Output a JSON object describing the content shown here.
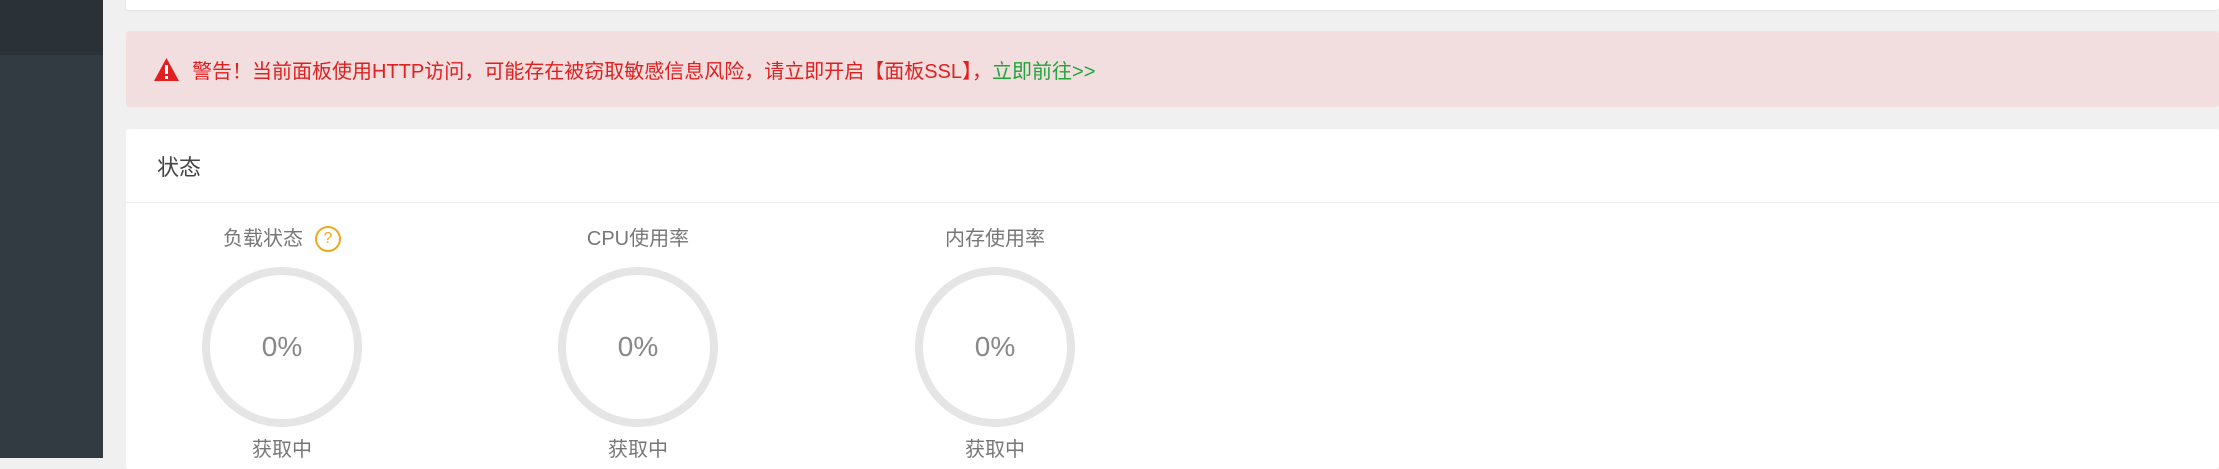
{
  "warning": {
    "text": "警告！当前面板使用HTTP访问，可能存在被窃取敏感信息风险，请立即开启【面板SSL】，",
    "link": "立即前往>>"
  },
  "status": {
    "title": "状态",
    "gauges": [
      {
        "label": "负载状态",
        "value": "0%",
        "status": "获取中",
        "has_help": true
      },
      {
        "label": "CPU使用率",
        "value": "0%",
        "status": "获取中"
      },
      {
        "label": "内存使用率",
        "value": "0%",
        "status": "获取中"
      }
    ]
  },
  "colors": {
    "sidebar": "#333b42",
    "warning_text": "#e02020",
    "warning_bg": "#f2dede",
    "link_green": "#20a53a",
    "help_orange": "#f0a81e"
  },
  "icons": {
    "warning": "warning-triangle-icon",
    "help": "question-circle-icon"
  }
}
